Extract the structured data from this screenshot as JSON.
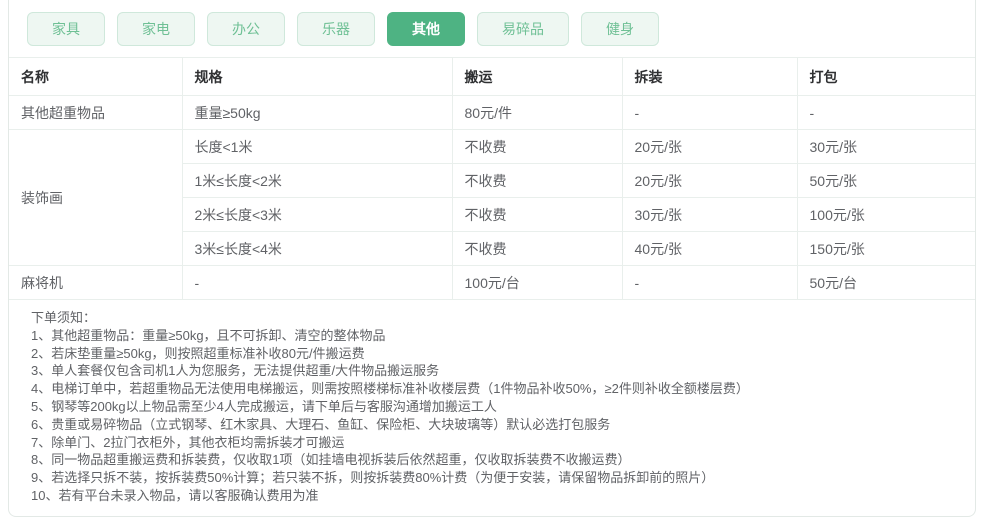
{
  "tabs": {
    "items": [
      {
        "key": "furniture",
        "label": "家具",
        "active": false
      },
      {
        "key": "appliance",
        "label": "家电",
        "active": false
      },
      {
        "key": "office",
        "label": "办公",
        "active": false
      },
      {
        "key": "instrument",
        "label": "乐器",
        "active": false
      },
      {
        "key": "other",
        "label": "其他",
        "active": true
      },
      {
        "key": "fragile",
        "label": "易碎品",
        "active": false
      },
      {
        "key": "fitness",
        "label": "健身",
        "active": false
      }
    ]
  },
  "colors": {
    "tab_active_bg": "#4eb383",
    "tab_active_text": "#ffffff",
    "tab_inactive_bg": "#eef7f2",
    "tab_inactive_border": "#cfe8db",
    "tab_inactive_text": "#6fc095",
    "card_border": "#e3e9e6",
    "table_border": "#e9efec",
    "header_text": "#303133",
    "body_text": "#606266"
  },
  "table": {
    "columns": [
      {
        "key": "name",
        "label": "名称"
      },
      {
        "key": "spec",
        "label": "规格"
      },
      {
        "key": "carry",
        "label": "搬运"
      },
      {
        "key": "disassemble",
        "label": "拆装"
      },
      {
        "key": "pack",
        "label": "打包"
      }
    ],
    "groups": [
      {
        "name": "其他超重物品",
        "rows": [
          [
            "重量≥50kg",
            "80元/件",
            "-",
            "-"
          ]
        ]
      },
      {
        "name": "装饰画",
        "rows": [
          [
            "长度<1米",
            "不收费",
            "20元/张",
            "30元/张"
          ],
          [
            "1米≤长度<2米",
            "不收费",
            "20元/张",
            "50元/张"
          ],
          [
            "2米≤长度<3米",
            "不收费",
            "30元/张",
            "100元/张"
          ],
          [
            "3米≤长度<4米",
            "不收费",
            "40元/张",
            "150元/张"
          ]
        ]
      },
      {
        "name": "麻将机",
        "rows": [
          [
            "-",
            "100元/台",
            "-",
            "50元/台"
          ]
        ]
      }
    ]
  },
  "notes": {
    "title": "下单须知：",
    "items": [
      "1、其他超重物品：重量≥50kg，且不可拆卸、清空的整体物品",
      "2、若床垫重量≥50kg，则按照超重标准补收80元/件搬运费",
      "3、单人套餐仅包含司机1人为您服务，无法提供超重/大件物品搬运服务",
      "4、电梯订单中，若超重物品无法使用电梯搬运，则需按照楼梯标准补收楼层费（1件物品补收50%，≥2件则补收全额楼层费）",
      "5、钢琴等200kg以上物品需至少4人完成搬运，请下单后与客服沟通增加搬运工人",
      "6、贵重或易碎物品（立式钢琴、红木家具、大理石、鱼缸、保险柜、大块玻璃等）默认必选打包服务",
      "7、除单门、2拉门衣柜外，其他衣柜均需拆装才可搬运",
      "8、同一物品超重搬运费和拆装费，仅收取1项（如挂墙电视拆装后依然超重，仅收取拆装费不收搬运费）",
      "9、若选择只拆不装，按拆装费50%计算；若只装不拆，则按拆装费80%计费（为便于安装，请保留物品拆卸前的照片）",
      "10、若有平台未录入物品，请以客服确认费用为准"
    ]
  }
}
